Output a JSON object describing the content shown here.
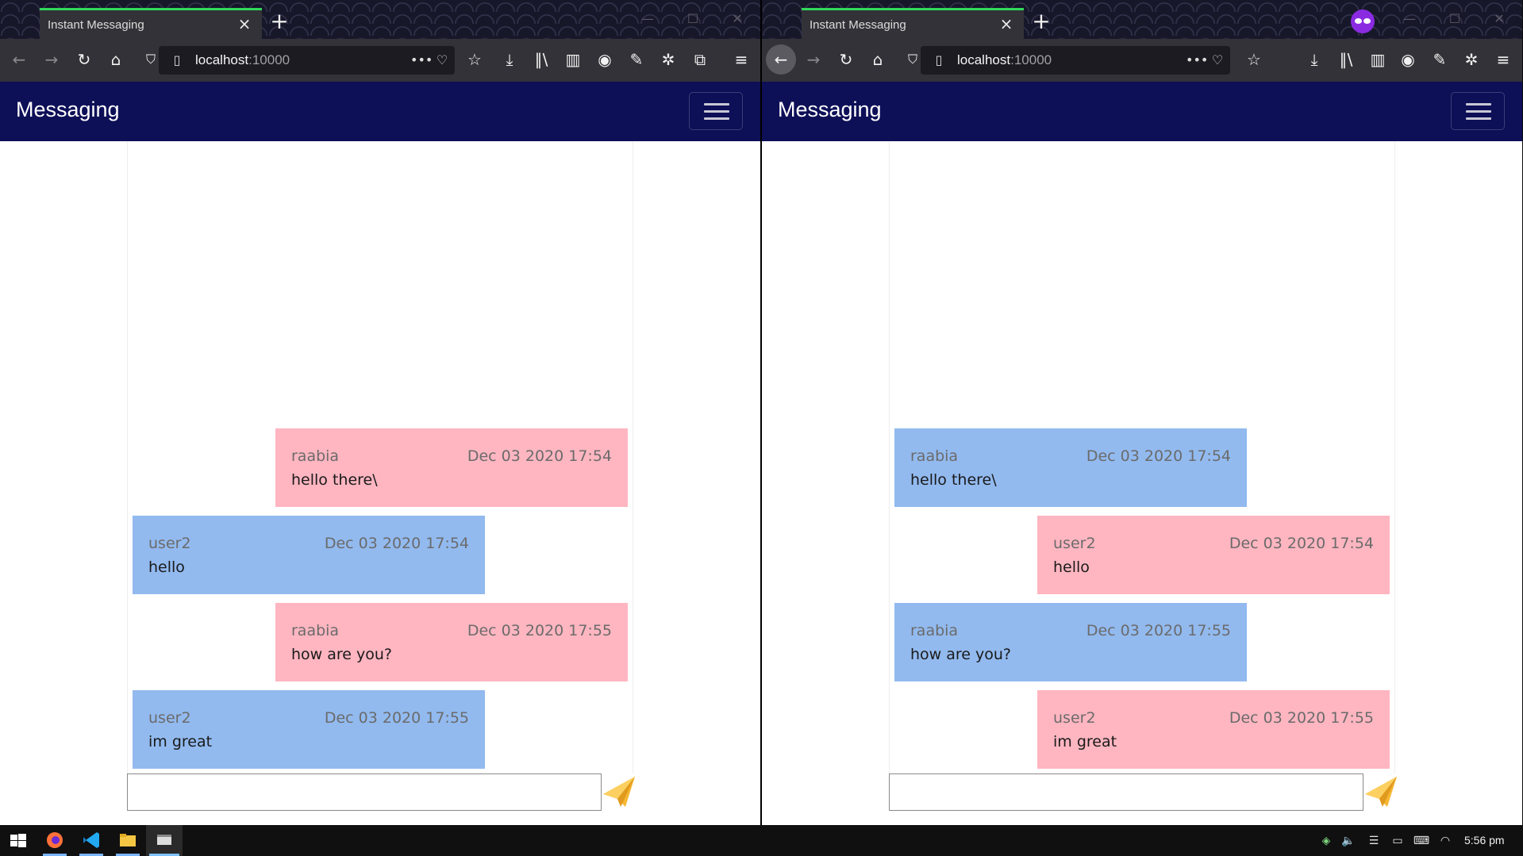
{
  "browser": {
    "tab_title": "Instant Messaging",
    "tab_close": "×",
    "new_tab": "+",
    "url_host": "localhost",
    "url_port": ":10000"
  },
  "app": {
    "brand": "Messaging",
    "composer_placeholder": ""
  },
  "left_window": {
    "messages": [
      {
        "user": "raabia",
        "time": "Dec 03 2020 17:54",
        "text": "hello there\\"
      },
      {
        "user": "user2",
        "time": "Dec 03 2020 17:54",
        "text": "hello"
      },
      {
        "user": "raabia",
        "time": "Dec 03 2020 17:55",
        "text": "how are you?"
      },
      {
        "user": "user2",
        "time": "Dec 03 2020 17:55",
        "text": "im great"
      }
    ]
  },
  "right_window": {
    "messages": [
      {
        "user": "raabia",
        "time": "Dec 03 2020 17:54",
        "text": "hello there\\"
      },
      {
        "user": "user2",
        "time": "Dec 03 2020 17:54",
        "text": "hello"
      },
      {
        "user": "raabia",
        "time": "Dec 03 2020 17:55",
        "text": "how are you?"
      },
      {
        "user": "user2",
        "time": "Dec 03 2020 17:55",
        "text": "im great"
      }
    ]
  },
  "colors": {
    "own_message": "#ffb6c1",
    "other_message": "#92baef",
    "header": "#0d0f57"
  },
  "taskbar": {
    "clock": "5:56 pm"
  }
}
